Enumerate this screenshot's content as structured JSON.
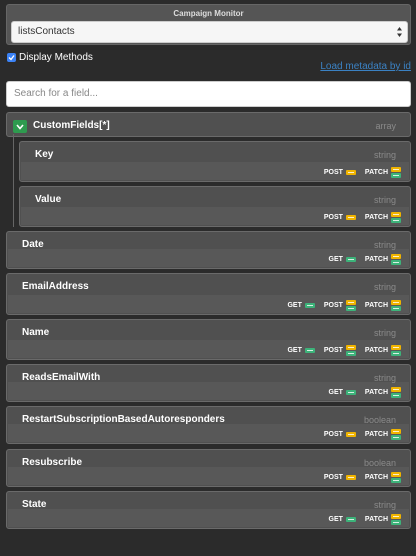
{
  "header": {
    "title": "Campaign Monitor",
    "select_value": "listsContacts"
  },
  "display_methods": {
    "label": "Display Methods",
    "checked": true
  },
  "load_metadata": "Load metadata by id",
  "search": {
    "placeholder": "Search for a field..."
  },
  "root_field": {
    "name": "CustomFields[*]",
    "type": "array"
  },
  "fields": [
    {
      "name": "Key",
      "type": "string",
      "methods": [
        "POST",
        "PATCH"
      ]
    },
    {
      "name": "Value",
      "type": "string",
      "methods": [
        "POST",
        "PATCH"
      ]
    },
    {
      "name": "Date",
      "type": "string",
      "methods": [
        "GET",
        "PATCH"
      ]
    },
    {
      "name": "EmailAddress",
      "type": "string",
      "methods": [
        "GET",
        "POST",
        "PATCH"
      ]
    },
    {
      "name": "Name",
      "type": "string",
      "methods": [
        "GET",
        "POST",
        "PATCH"
      ]
    },
    {
      "name": "ReadsEmailWith",
      "type": "string",
      "methods": [
        "GET",
        "PATCH"
      ]
    },
    {
      "name": "RestartSubscriptionBasedAutoresponders",
      "type": "boolean",
      "methods": [
        "POST",
        "PATCH"
      ]
    },
    {
      "name": "Resubscribe",
      "type": "boolean",
      "methods": [
        "POST",
        "PATCH"
      ]
    },
    {
      "name": "State",
      "type": "string",
      "methods": [
        "GET",
        "PATCH"
      ]
    }
  ],
  "colors": {
    "get_badge": "#3db37a",
    "post_badge": "#f0b400",
    "expand_button": "#2e9b4f",
    "link": "#3b82c4"
  }
}
